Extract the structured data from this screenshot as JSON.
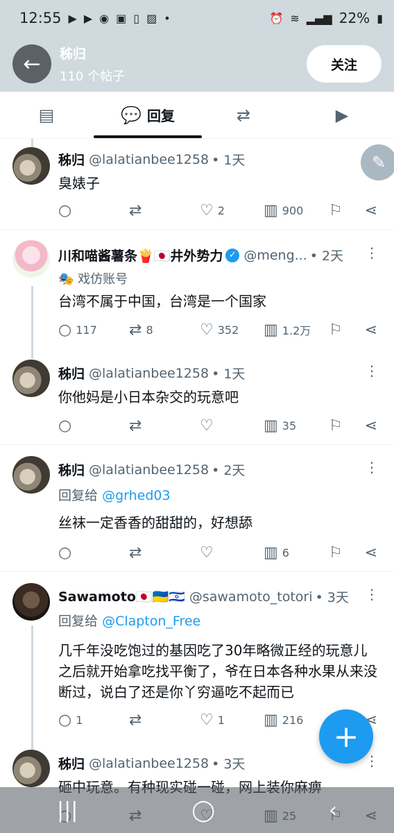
{
  "status_bar": {
    "time": "12:55",
    "battery": "22%",
    "left_icons": [
      "youtube-icon",
      "youtube-icon",
      "app-icon",
      "badge-icon",
      "phone-icon",
      "gallery-icon"
    ],
    "right_icons": [
      "alarm-icon",
      "wifi-icon",
      "signal-icon"
    ]
  },
  "header": {
    "name": "秭归",
    "post_count": "110 个帖子",
    "follow_label": "关注"
  },
  "tabs": [
    {
      "label": "",
      "icon": "articles-icon"
    },
    {
      "label": "回复",
      "icon": "reply-icon",
      "active": true
    },
    {
      "label": "",
      "icon": "retweet-icon"
    },
    {
      "label": "",
      "icon": "media-icon"
    }
  ],
  "posts": [
    {
      "name": "秭归",
      "handle": "@lalatianbee1258",
      "time": "• 1天",
      "text": "臭婊子",
      "reply": "",
      "retweet": "",
      "like": "2",
      "views": "900"
    },
    {
      "name": "川和喵酱薯条🍟🇯🇵井外势力",
      "handle": "@meng...",
      "time": "• 2天",
      "badge": "戏仿账号",
      "text": "台湾不属于中国，台湾是一个国家",
      "reply": "117",
      "retweet": "8",
      "like": "352",
      "views": "1.2万"
    },
    {
      "name": "秭归",
      "handle": "@lalatianbee1258",
      "time": "• 1天",
      "text": "你他妈是小日本杂交的玩意吧",
      "reply": "",
      "retweet": "",
      "like": "",
      "views": "35"
    },
    {
      "name": "秭归",
      "handle": "@lalatianbee1258",
      "time": "• 2天",
      "reply_to_prefix": "回复给",
      "reply_to": "@grhed03",
      "text": "丝袜一定香香的甜甜的，好想舔",
      "reply": "",
      "retweet": "",
      "like": "",
      "views": "6"
    },
    {
      "name": "Sawamoto🇯🇵🇺🇦🇮🇱",
      "handle": "@sawamoto_totori",
      "time": "• 3天",
      "reply_to_prefix": "回复给",
      "reply_to": "@Clapton_Free",
      "text": "几千年没吃饱过的基因吃了30年略微正经的玩意儿之后就开始拿吃找平衡了，爷在日本各种水果从来没断过，说白了还是你丫穷逼吃不起而已",
      "reply": "1",
      "retweet": "",
      "like": "1",
      "views": "216"
    },
    {
      "name": "秭归",
      "handle": "@lalatianbee1258",
      "time": "• 3天",
      "text": "砸中玩意。有种现实碰一碰，网上装你麻痹",
      "reply": "",
      "retweet": "",
      "like": "",
      "views": "25"
    }
  ],
  "fab": {
    "icon": "plus-icon",
    "label": "+"
  },
  "colors": {
    "accent": "#1d9bf0",
    "header_bg": "#cfd9de",
    "muted": "#536471"
  }
}
